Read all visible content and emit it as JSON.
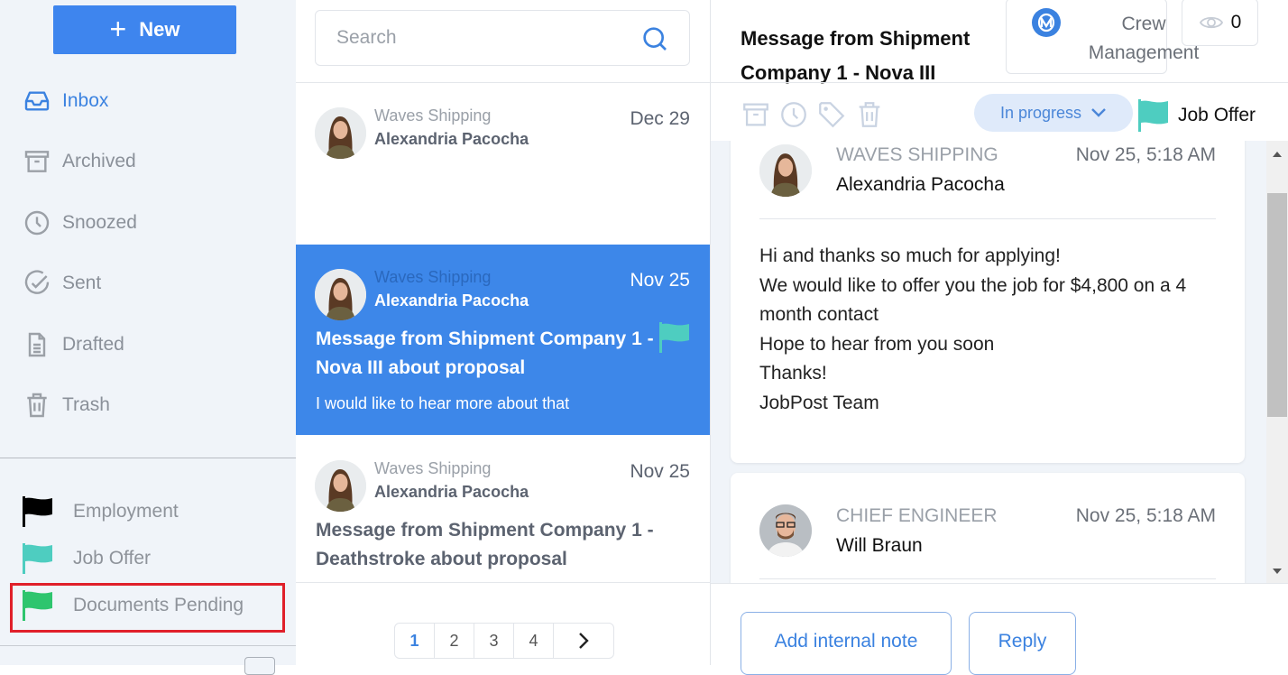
{
  "sidebar": {
    "new_button": {
      "icon": "plus-icon",
      "label": "New"
    },
    "nav": [
      {
        "icon": "inbox-icon",
        "label": "Inbox",
        "active": true
      },
      {
        "icon": "archive-icon",
        "label": "Archived"
      },
      {
        "icon": "clock-icon",
        "label": "Snoozed"
      },
      {
        "icon": "check-circle-icon",
        "label": "Sent"
      },
      {
        "icon": "document-icon",
        "label": "Drafted"
      },
      {
        "icon": "trash-icon",
        "label": "Trash"
      }
    ],
    "labels": [
      {
        "icon": "flag-icon",
        "label": "Employment",
        "color": "#000000"
      },
      {
        "icon": "flag-icon",
        "label": "Job Offer",
        "color": "#4ecdc0"
      },
      {
        "icon": "flag-icon",
        "label": "Documents Pending",
        "color": "#2ec56e",
        "highlighted": true
      }
    ]
  },
  "list": {
    "search": {
      "placeholder": "Search",
      "value": ""
    },
    "messages": [
      {
        "company": "Waves Shipping",
        "sender": "Alexandria Pacocha",
        "date": "Dec 29",
        "subject": "",
        "preview": ""
      },
      {
        "company": "Waves Shipping",
        "sender": "Alexandria Pacocha",
        "date": "Nov 25",
        "subject": "Message from Shipment Company 1 - Nova III about proposal",
        "preview": "I would like to hear more about that",
        "selected": true,
        "flag_color": "#4ecdc0"
      },
      {
        "company": "Waves Shipping",
        "sender": "Alexandria Pacocha",
        "date": "Nov 25",
        "subject": "Message from Shipment Company 1 - Deathstroke about proposal",
        "preview": ""
      }
    ],
    "pagination": {
      "pages": [
        "1",
        "2",
        "3",
        "4"
      ],
      "current": "1",
      "next_icon": "chevron-right-icon"
    }
  },
  "detail": {
    "title": "Message from Shipment Company 1 - Nova III",
    "company_badge": {
      "logo_letter": "M",
      "name": "Crew Management"
    },
    "views": {
      "icon": "eye-icon",
      "count": "0"
    },
    "toolbar": [
      "archive-icon",
      "clock-icon",
      "tag-icon",
      "trash-icon"
    ],
    "status": {
      "label": "In progress",
      "icon": "chevron-down-icon"
    },
    "label": {
      "name": "Job Offer",
      "color": "#4ecdc0"
    },
    "thread": [
      {
        "role": "WAVES SHIPPING",
        "name": "Alexandria Pacocha",
        "time": "Nov 25, 5:18 AM",
        "body": [
          "Hi and thanks so much for applying!",
          "We would like to offer you the job for $4,800 on a 4 month contact",
          "Hope to hear from you soon",
          "Thanks!",
          "JobPost Team"
        ]
      },
      {
        "role": "CHIEF ENGINEER",
        "name": "Will Braun",
        "time": "Nov 25, 5:18 AM",
        "body": []
      }
    ],
    "actions": {
      "internal_note": "Add internal note",
      "reply": "Reply"
    }
  },
  "colors": {
    "accent": "#3d87e9",
    "highlight_box": "#e0202a"
  }
}
